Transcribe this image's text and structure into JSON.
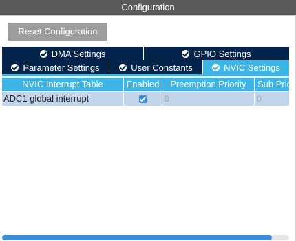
{
  "panel": {
    "title": "Configuration"
  },
  "toolbar": {
    "reset_label": "Reset Configuration"
  },
  "tabs": {
    "row1": [
      {
        "label": "DMA Settings",
        "active": false
      },
      {
        "label": "GPIO Settings",
        "active": false
      }
    ],
    "row2": [
      {
        "label": "Parameter Settings",
        "active": false
      },
      {
        "label": "User Constants",
        "active": false
      },
      {
        "label": "NVIC Settings",
        "active": true
      }
    ]
  },
  "table": {
    "headers": [
      "NVIC Interrupt Table",
      "Enabled",
      "Preemption Priority",
      "Sub Priority"
    ],
    "rows": [
      {
        "name": "ADC1 global interrupt",
        "enabled": true,
        "preemption": "0",
        "sub": "0"
      }
    ]
  },
  "colors": {
    "tab_dark": "#03234b",
    "tab_active": "#3cb4e6",
    "row_bg": "#c3d5ea",
    "accent": "#3a8ed8"
  }
}
